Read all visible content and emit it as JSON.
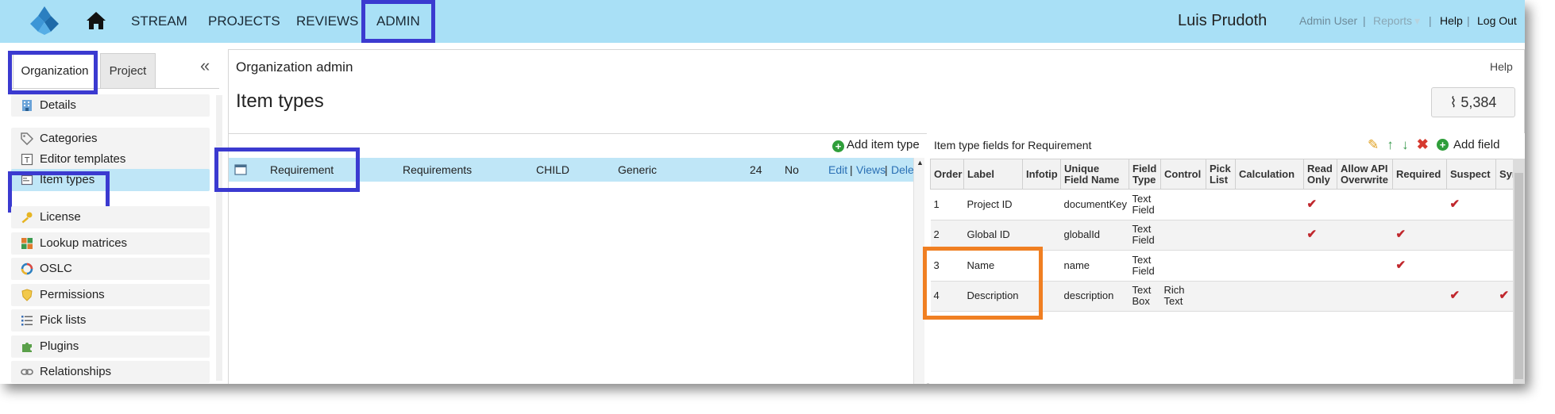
{
  "nav": {
    "items": [
      "STREAM",
      "PROJECTS",
      "REVIEWS",
      "ADMIN"
    ],
    "user_name": "Luis Prudoth",
    "links": {
      "admin_user": "Admin User",
      "reports": "Reports",
      "help": "Help",
      "logout": "Log Out",
      "separator": "|"
    }
  },
  "sidebar": {
    "tabs": [
      "Organization",
      "Project"
    ],
    "collapse_glyph": "«",
    "items": [
      {
        "label": "Details",
        "icon": "building-icon"
      },
      {
        "label": "Categories",
        "icon": "tag-icon"
      },
      {
        "label": "Editor templates",
        "icon": "template-icon"
      },
      {
        "label": "Item types",
        "icon": "item-types-icon"
      },
      {
        "label": "License",
        "icon": "key-icon"
      },
      {
        "label": "Lookup matrices",
        "icon": "matrix-icon"
      },
      {
        "label": "OSLC",
        "icon": "oslc-icon"
      },
      {
        "label": "Permissions",
        "icon": "shield-icon"
      },
      {
        "label": "Pick lists",
        "icon": "list-icon"
      },
      {
        "label": "Plugins",
        "icon": "puzzle-icon"
      },
      {
        "label": "Relationships",
        "icon": "link-icon"
      }
    ],
    "active_item": "Item types"
  },
  "main": {
    "section": "Organization admin",
    "help": "Help",
    "title": "Item types",
    "activity_count": "5,384",
    "activity_glyph": "⌇"
  },
  "item_types": {
    "add_label": "Add item type",
    "rows": [
      {
        "name": "Requirement",
        "plural": "Requirements",
        "type": "CHILD",
        "category": "Generic",
        "count": "24",
        "flag": "No",
        "actions": {
          "edit": "Edit",
          "views": "Views",
          "delete": "Dele",
          "sep": "|"
        }
      }
    ]
  },
  "fields": {
    "title": "Item type fields for Requirement",
    "add_label": "Add field",
    "columns": [
      "Order",
      "Label",
      "Infotip",
      "Unique Field Name",
      "Field Type",
      "Control",
      "Pick List",
      "Calculation",
      "Read Only",
      "Allow API Overwrite",
      "Required",
      "Suspect",
      "Syn"
    ],
    "check_glyph": "✔",
    "rows": [
      {
        "order": "1",
        "label": "Project ID",
        "infotip": "",
        "unique": "documentKey",
        "field_type": "Text Field",
        "control": "",
        "pick_list": "",
        "calculation": "",
        "read_only": true,
        "api_overwrite": false,
        "required": false,
        "suspect": true,
        "sync": false
      },
      {
        "order": "2",
        "label": "Global ID",
        "infotip": "",
        "unique": "globalId",
        "field_type": "Text Field",
        "control": "",
        "pick_list": "",
        "calculation": "",
        "read_only": true,
        "api_overwrite": false,
        "required": true,
        "suspect": false,
        "sync": false
      },
      {
        "order": "3",
        "label": "Name",
        "infotip": "",
        "unique": "name",
        "field_type": "Text Field",
        "control": "",
        "pick_list": "",
        "calculation": "",
        "read_only": false,
        "api_overwrite": false,
        "required": true,
        "suspect": false,
        "sync": false
      },
      {
        "order": "4",
        "label": "Description",
        "infotip": "",
        "unique": "description",
        "field_type": "Text Box",
        "control": "Rich Text",
        "pick_list": "",
        "calculation": "",
        "read_only": false,
        "api_overwrite": false,
        "required": false,
        "suspect": true,
        "sync": true
      }
    ]
  },
  "colors": {
    "nav_bg": "#a9e0f6",
    "highlight_blue": "#3b3ad0",
    "highlight_orange": "#f07f22",
    "selected_row": "#bfe6f7",
    "link": "#2a6fb4",
    "check": "#c0272d"
  }
}
